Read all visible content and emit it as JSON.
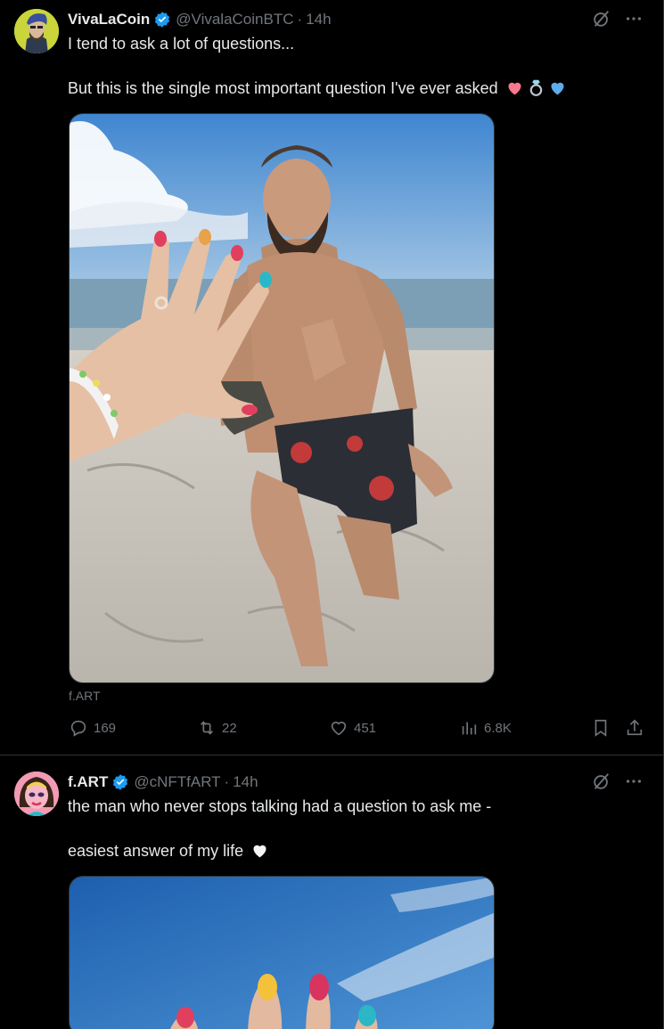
{
  "tweets": [
    {
      "author": {
        "name": "VivaLaCoin",
        "handle": "@VivalaCoinBTC",
        "time": "14h"
      },
      "text_line1": "I tend to ask a lot of questions...",
      "text_line2": "But this is the single most important question I've ever asked",
      "emojis": [
        "pink-heart",
        "ring",
        "blue-heart"
      ],
      "media_alt": "Bearded man on one knee on a beach behind a woman's hand showing an engagement ring",
      "source_label": "f.ART",
      "stats": {
        "replies": "169",
        "reposts": "22",
        "likes": "451",
        "views": "6.8K"
      }
    },
    {
      "author": {
        "name": "f.ART",
        "handle": "@cNFTfART",
        "time": "14h"
      },
      "text_line1": "the man who never stops talking had a question to ask me -",
      "text_line2": "easiest answer of my life",
      "emojis": [
        "white-heart"
      ],
      "media_alt": "Hand with colorful painted nails against a blue sky"
    }
  ],
  "separator": "·",
  "colors": {
    "background": "#000000",
    "text": "#e7e9ea",
    "muted": "#71767b",
    "verified": "#1d9bf0",
    "border": "#2f3336"
  }
}
